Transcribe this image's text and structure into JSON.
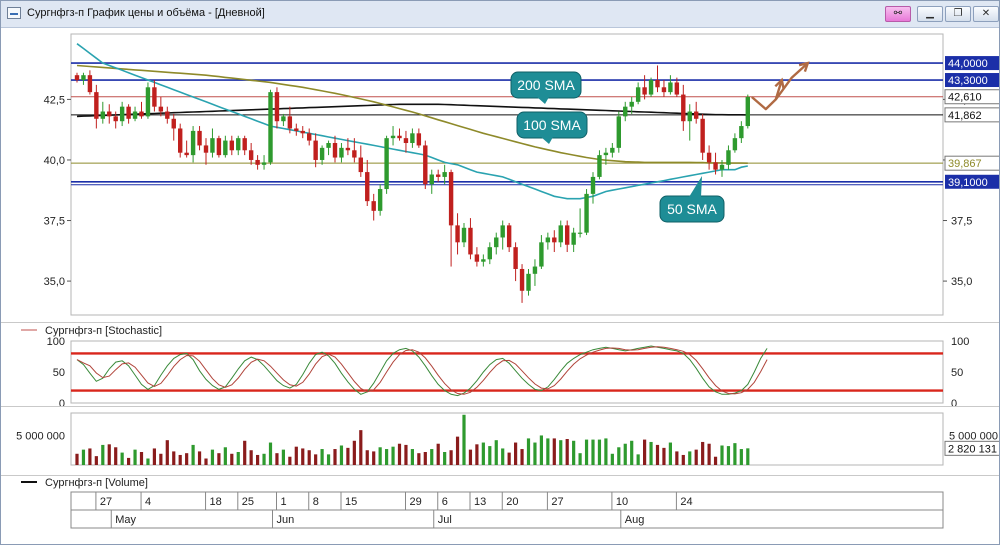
{
  "window": {
    "title": "Сургнфгз-п График цены и объёма - [Дневной]",
    "icons": [
      "chart-window-icon",
      "link-icon",
      "minimize-icon",
      "restore-icon",
      "close-icon"
    ]
  },
  "colors": {
    "up": "#2e9a2e",
    "down": "#c0201e",
    "sma50": "#2aa3b0",
    "sma100": "#8e8a2a",
    "sma200": "#111111",
    "level_blue": "#1b2fa8",
    "level_red": "#c0504d",
    "stoch_band": "#d9261c",
    "callout": "#1e8d96",
    "arrow": "#b06a43"
  },
  "price_pane": {
    "y_ticks": [
      "42,5",
      "40,0",
      "37,5",
      "35,0"
    ],
    "levels": [
      {
        "label": "44,0000",
        "value": 44.0,
        "style": "blue-box"
      },
      {
        "label": "43,3000",
        "value": 43.3,
        "style": "blue-box"
      },
      {
        "label": "42,610",
        "value": 42.61,
        "style": "red-text"
      },
      {
        "label": "41,862",
        "value": 41.862,
        "style": "black-text"
      },
      {
        "label": "39,867",
        "value": 39.867,
        "style": "olive-text"
      },
      {
        "label": "39,1000",
        "value": 39.1,
        "style": "blue-box"
      }
    ],
    "callouts": {
      "sma200": "200 SMA",
      "sma100": "100 SMA",
      "sma50": "50 SMA"
    }
  },
  "stoch_pane": {
    "legend": "Сургнфгз-п [Stochastic]",
    "left_ticks": [
      "100",
      "50",
      "0"
    ],
    "right_ticks": [
      "100",
      "50",
      "0"
    ],
    "bands": [
      80,
      20
    ]
  },
  "volume_pane": {
    "left_tick": "5 000 000",
    "right_tick": "5 000 000",
    "last_label": "2 820 131",
    "legend": "Сургнфгз-п [Volume]"
  },
  "date_axis": {
    "days": [
      "27",
      "4",
      "18",
      "25",
      "1",
      "8",
      "15",
      "29",
      "6",
      "13",
      "20",
      "27",
      "10",
      "24"
    ],
    "months": [
      "May",
      "Jun",
      "Jul",
      "Aug"
    ]
  },
  "chart_data": {
    "type": "candlestick",
    "y_range": [
      33.6,
      45.2
    ],
    "x_categories": [
      "27",
      "4",
      "18",
      "25",
      "1",
      "8",
      "15",
      "29",
      "6",
      "13",
      "20",
      "27",
      "10",
      "24"
    ],
    "months": [
      "May",
      "Jun",
      "Jul",
      "Aug"
    ],
    "horizontal_levels": [
      44.0,
      43.3,
      42.61,
      41.862,
      39.867,
      39.1
    ],
    "candles": [
      {
        "o": 43.5,
        "h": 43.6,
        "l": 43.2,
        "c": 43.3
      },
      {
        "o": 43.3,
        "h": 43.6,
        "l": 43.1,
        "c": 43.5
      },
      {
        "o": 43.5,
        "h": 43.7,
        "l": 42.7,
        "c": 42.8
      },
      {
        "o": 42.8,
        "h": 43.1,
        "l": 41.3,
        "c": 41.7
      },
      {
        "o": 41.7,
        "h": 42.4,
        "l": 41.5,
        "c": 42.0
      },
      {
        "o": 42.0,
        "h": 42.3,
        "l": 41.5,
        "c": 41.8
      },
      {
        "o": 41.8,
        "h": 42.0,
        "l": 41.3,
        "c": 41.6
      },
      {
        "o": 41.6,
        "h": 42.4,
        "l": 41.4,
        "c": 42.2
      },
      {
        "o": 42.2,
        "h": 42.3,
        "l": 41.5,
        "c": 41.7
      },
      {
        "o": 41.7,
        "h": 42.2,
        "l": 41.6,
        "c": 42.0
      },
      {
        "o": 42.0,
        "h": 42.4,
        "l": 41.7,
        "c": 41.8
      },
      {
        "o": 41.8,
        "h": 43.2,
        "l": 41.7,
        "c": 43.0
      },
      {
        "o": 43.0,
        "h": 43.3,
        "l": 42.0,
        "c": 42.2
      },
      {
        "o": 42.2,
        "h": 42.6,
        "l": 41.8,
        "c": 42.0
      },
      {
        "o": 42.0,
        "h": 42.2,
        "l": 41.5,
        "c": 41.7
      },
      {
        "o": 41.7,
        "h": 41.9,
        "l": 40.8,
        "c": 41.3
      },
      {
        "o": 41.3,
        "h": 41.5,
        "l": 40.1,
        "c": 40.3
      },
      {
        "o": 40.3,
        "h": 40.8,
        "l": 40.1,
        "c": 40.2
      },
      {
        "o": 40.2,
        "h": 41.4,
        "l": 39.9,
        "c": 41.2
      },
      {
        "o": 41.2,
        "h": 41.4,
        "l": 40.4,
        "c": 40.6
      },
      {
        "o": 40.6,
        "h": 40.9,
        "l": 39.8,
        "c": 40.3
      },
      {
        "o": 40.3,
        "h": 41.3,
        "l": 40.1,
        "c": 40.9
      },
      {
        "o": 40.9,
        "h": 41.0,
        "l": 40.1,
        "c": 40.2
      },
      {
        "o": 40.2,
        "h": 41.0,
        "l": 40.1,
        "c": 40.8
      },
      {
        "o": 40.8,
        "h": 41.0,
        "l": 40.2,
        "c": 40.4
      },
      {
        "o": 40.4,
        "h": 41.0,
        "l": 40.2,
        "c": 40.9
      },
      {
        "o": 40.9,
        "h": 41.0,
        "l": 40.2,
        "c": 40.4
      },
      {
        "o": 40.4,
        "h": 40.7,
        "l": 39.8,
        "c": 40.0
      },
      {
        "o": 40.0,
        "h": 40.2,
        "l": 39.6,
        "c": 39.8
      },
      {
        "o": 39.8,
        "h": 40.2,
        "l": 39.6,
        "c": 39.9
      },
      {
        "o": 39.9,
        "h": 42.9,
        "l": 39.8,
        "c": 42.8
      },
      {
        "o": 42.8,
        "h": 43.0,
        "l": 41.3,
        "c": 41.6
      },
      {
        "o": 41.6,
        "h": 41.9,
        "l": 41.4,
        "c": 41.8
      },
      {
        "o": 41.8,
        "h": 42.2,
        "l": 41.1,
        "c": 41.3
      },
      {
        "o": 41.3,
        "h": 41.5,
        "l": 41.0,
        "c": 41.2
      },
      {
        "o": 41.2,
        "h": 41.4,
        "l": 40.9,
        "c": 41.1
      },
      {
        "o": 41.1,
        "h": 41.3,
        "l": 40.6,
        "c": 40.8
      },
      {
        "o": 40.8,
        "h": 41.1,
        "l": 39.7,
        "c": 40.0
      },
      {
        "o": 40.0,
        "h": 40.6,
        "l": 39.8,
        "c": 40.5
      },
      {
        "o": 40.5,
        "h": 40.8,
        "l": 40.2,
        "c": 40.7
      },
      {
        "o": 40.7,
        "h": 41.0,
        "l": 39.9,
        "c": 40.1
      },
      {
        "o": 40.1,
        "h": 40.7,
        "l": 39.9,
        "c": 40.5
      },
      {
        "o": 40.5,
        "h": 40.9,
        "l": 40.2,
        "c": 40.4
      },
      {
        "o": 40.4,
        "h": 40.9,
        "l": 39.9,
        "c": 40.1
      },
      {
        "o": 40.1,
        "h": 40.6,
        "l": 39.3,
        "c": 39.5
      },
      {
        "o": 39.5,
        "h": 40.0,
        "l": 38.1,
        "c": 38.3
      },
      {
        "o": 38.3,
        "h": 38.6,
        "l": 37.5,
        "c": 37.9
      },
      {
        "o": 37.9,
        "h": 39.0,
        "l": 37.7,
        "c": 38.8
      },
      {
        "o": 38.8,
        "h": 41.0,
        "l": 38.6,
        "c": 40.9
      },
      {
        "o": 40.9,
        "h": 41.4,
        "l": 40.6,
        "c": 41.0
      },
      {
        "o": 41.0,
        "h": 41.3,
        "l": 40.8,
        "c": 40.9
      },
      {
        "o": 40.9,
        "h": 41.2,
        "l": 40.3,
        "c": 40.7
      },
      {
        "o": 40.7,
        "h": 41.3,
        "l": 40.5,
        "c": 41.1
      },
      {
        "o": 41.1,
        "h": 41.3,
        "l": 40.5,
        "c": 40.6
      },
      {
        "o": 40.6,
        "h": 40.8,
        "l": 38.8,
        "c": 39.0
      },
      {
        "o": 39.0,
        "h": 39.6,
        "l": 38.6,
        "c": 39.4
      },
      {
        "o": 39.4,
        "h": 39.6,
        "l": 39.1,
        "c": 39.3
      },
      {
        "o": 39.3,
        "h": 39.8,
        "l": 39.0,
        "c": 39.5
      },
      {
        "o": 39.5,
        "h": 39.6,
        "l": 35.6,
        "c": 37.3
      },
      {
        "o": 37.3,
        "h": 37.8,
        "l": 36.1,
        "c": 36.6
      },
      {
        "o": 36.6,
        "h": 37.4,
        "l": 36.4,
        "c": 37.2
      },
      {
        "o": 37.2,
        "h": 37.6,
        "l": 35.9,
        "c": 36.1
      },
      {
        "o": 36.1,
        "h": 36.4,
        "l": 35.6,
        "c": 35.8
      },
      {
        "o": 35.8,
        "h": 36.1,
        "l": 35.6,
        "c": 35.9
      },
      {
        "o": 35.9,
        "h": 36.6,
        "l": 35.7,
        "c": 36.4
      },
      {
        "o": 36.4,
        "h": 37.0,
        "l": 36.1,
        "c": 36.8
      },
      {
        "o": 36.8,
        "h": 37.5,
        "l": 36.3,
        "c": 37.3
      },
      {
        "o": 37.3,
        "h": 37.4,
        "l": 36.2,
        "c": 36.4
      },
      {
        "o": 36.4,
        "h": 36.6,
        "l": 35.0,
        "c": 35.5
      },
      {
        "o": 35.5,
        "h": 35.7,
        "l": 34.1,
        "c": 34.6
      },
      {
        "o": 34.6,
        "h": 35.5,
        "l": 34.4,
        "c": 35.3
      },
      {
        "o": 35.3,
        "h": 35.9,
        "l": 34.8,
        "c": 35.6
      },
      {
        "o": 35.6,
        "h": 36.9,
        "l": 35.5,
        "c": 36.6
      },
      {
        "o": 36.6,
        "h": 37.0,
        "l": 36.3,
        "c": 36.8
      },
      {
        "o": 36.8,
        "h": 37.1,
        "l": 36.2,
        "c": 36.6
      },
      {
        "o": 36.6,
        "h": 37.5,
        "l": 36.4,
        "c": 37.3
      },
      {
        "o": 37.3,
        "h": 37.5,
        "l": 36.2,
        "c": 36.5
      },
      {
        "o": 36.5,
        "h": 37.2,
        "l": 36.2,
        "c": 37.0
      },
      {
        "o": 37.0,
        "h": 38.0,
        "l": 36.8,
        "c": 37.0
      },
      {
        "o": 37.0,
        "h": 38.8,
        "l": 36.9,
        "c": 38.6
      },
      {
        "o": 38.6,
        "h": 39.5,
        "l": 38.2,
        "c": 39.3
      },
      {
        "o": 39.3,
        "h": 40.4,
        "l": 39.2,
        "c": 40.2
      },
      {
        "o": 40.2,
        "h": 40.5,
        "l": 39.8,
        "c": 40.3
      },
      {
        "o": 40.3,
        "h": 40.7,
        "l": 40.1,
        "c": 40.5
      },
      {
        "o": 40.5,
        "h": 42.0,
        "l": 40.3,
        "c": 41.8
      },
      {
        "o": 41.8,
        "h": 42.4,
        "l": 41.6,
        "c": 42.2
      },
      {
        "o": 42.2,
        "h": 42.6,
        "l": 41.9,
        "c": 42.4
      },
      {
        "o": 42.4,
        "h": 43.2,
        "l": 42.3,
        "c": 43.0
      },
      {
        "o": 43.0,
        "h": 43.5,
        "l": 42.5,
        "c": 42.7
      },
      {
        "o": 42.7,
        "h": 43.4,
        "l": 42.6,
        "c": 43.3
      },
      {
        "o": 43.3,
        "h": 43.9,
        "l": 42.8,
        "c": 43.0
      },
      {
        "o": 43.0,
        "h": 43.3,
        "l": 42.6,
        "c": 42.8
      },
      {
        "o": 42.8,
        "h": 43.5,
        "l": 42.7,
        "c": 43.2
      },
      {
        "o": 43.2,
        "h": 43.4,
        "l": 42.6,
        "c": 42.7
      },
      {
        "o": 42.7,
        "h": 43.1,
        "l": 41.2,
        "c": 41.6
      },
      {
        "o": 41.6,
        "h": 42.3,
        "l": 40.8,
        "c": 42.0
      },
      {
        "o": 42.0,
        "h": 42.4,
        "l": 41.5,
        "c": 41.7
      },
      {
        "o": 41.7,
        "h": 41.9,
        "l": 40.0,
        "c": 40.3
      },
      {
        "o": 40.3,
        "h": 40.6,
        "l": 39.6,
        "c": 39.9
      },
      {
        "o": 39.9,
        "h": 40.3,
        "l": 39.4,
        "c": 39.6
      },
      {
        "o": 39.6,
        "h": 40.0,
        "l": 39.3,
        "c": 39.8
      },
      {
        "o": 39.8,
        "h": 40.6,
        "l": 39.6,
        "c": 40.4
      },
      {
        "o": 40.4,
        "h": 41.1,
        "l": 40.3,
        "c": 40.9
      },
      {
        "o": 40.9,
        "h": 41.6,
        "l": 40.7,
        "c": 41.4
      },
      {
        "o": 41.4,
        "h": 42.7,
        "l": 41.3,
        "c": 42.6
      }
    ],
    "sma50": [
      44.8,
      44.6,
      44.4,
      44.2,
      44.0,
      43.9,
      43.8,
      43.7,
      43.6,
      43.5,
      43.4,
      43.3,
      43.2,
      43.1,
      43.0,
      42.9,
      42.8,
      42.7,
      42.6,
      42.5,
      42.4,
      42.3,
      42.2,
      42.1,
      42.0,
      41.9,
      41.8,
      41.7,
      41.6,
      41.5,
      41.4,
      41.35,
      41.3,
      41.25,
      41.2,
      41.15,
      41.1,
      41.05,
      41.0,
      40.95,
      40.9,
      40.85,
      40.8,
      40.75,
      40.7,
      40.65,
      40.6,
      40.55,
      40.5,
      40.45,
      40.4,
      40.35,
      40.3,
      40.25,
      40.2,
      40.1,
      40.0,
      39.9,
      39.85,
      39.8,
      39.7,
      39.6,
      39.5,
      39.45,
      39.4,
      39.35,
      39.3,
      39.2,
      39.1,
      39.0,
      38.9,
      38.8,
      38.7,
      38.6,
      38.5,
      38.45,
      38.4,
      38.4,
      38.4,
      38.45,
      38.5,
      38.6,
      38.7,
      38.75,
      38.8,
      38.85,
      38.9,
      38.95,
      39.0,
      39.05,
      39.1,
      39.15,
      39.2,
      39.25,
      39.3,
      39.35,
      39.4,
      39.45,
      39.5,
      39.55,
      39.6,
      39.6,
      39.6,
      39.7,
      39.75
    ],
    "sma100": [
      43.9,
      43.88,
      43.86,
      43.84,
      43.82,
      43.8,
      43.78,
      43.76,
      43.74,
      43.72,
      43.7,
      43.68,
      43.66,
      43.64,
      43.62,
      43.6,
      43.58,
      43.56,
      43.54,
      43.52,
      43.5,
      43.47,
      43.44,
      43.41,
      43.38,
      43.35,
      43.32,
      43.29,
      43.26,
      43.23,
      43.2,
      43.16,
      43.12,
      43.08,
      43.04,
      43.0,
      42.95,
      42.9,
      42.85,
      42.8,
      42.75,
      42.7,
      42.64,
      42.58,
      42.52,
      42.46,
      42.4,
      42.33,
      42.26,
      42.19,
      42.12,
      42.05,
      41.98,
      41.9,
      41.82,
      41.74,
      41.66,
      41.58,
      41.5,
      41.42,
      41.34,
      41.26,
      41.18,
      41.1,
      41.03,
      40.96,
      40.89,
      40.82,
      40.75,
      40.68,
      40.61,
      40.54,
      40.48,
      40.42,
      40.36,
      40.3,
      40.25,
      40.2,
      40.15,
      40.1,
      40.06,
      40.02,
      39.99,
      39.97,
      39.95,
      39.93,
      39.92,
      39.91,
      39.9,
      39.9,
      39.9,
      39.9,
      39.9,
      39.9,
      39.9,
      39.9,
      39.89,
      39.89,
      39.88,
      39.88,
      39.88,
      39.87,
      39.87,
      39.87,
      39.867
    ],
    "sma200": [
      41.8,
      41.81,
      41.82,
      41.83,
      41.84,
      41.85,
      41.86,
      41.87,
      41.88,
      41.89,
      41.9,
      41.91,
      41.92,
      41.93,
      41.94,
      41.95,
      41.96,
      41.97,
      41.98,
      41.99,
      42.0,
      42.01,
      42.02,
      42.03,
      42.04,
      42.05,
      42.06,
      42.07,
      42.08,
      42.09,
      42.1,
      42.11,
      42.12,
      42.13,
      42.14,
      42.15,
      42.16,
      42.17,
      42.18,
      42.19,
      42.2,
      42.21,
      42.22,
      42.23,
      42.24,
      42.25,
      42.26,
      42.27,
      42.28,
      42.29,
      42.3,
      42.3,
      42.3,
      42.3,
      42.3,
      42.3,
      42.3,
      42.29,
      42.28,
      42.27,
      42.26,
      42.25,
      42.24,
      42.23,
      42.22,
      42.21,
      42.2,
      42.19,
      42.18,
      42.17,
      42.16,
      42.15,
      42.14,
      42.13,
      42.12,
      42.11,
      42.1,
      42.09,
      42.08,
      42.07,
      42.06,
      42.05,
      42.04,
      42.03,
      42.02,
      42.01,
      42.0,
      41.99,
      41.98,
      41.97,
      41.96,
      41.95,
      41.94,
      41.93,
      41.92,
      41.91,
      41.9,
      41.89,
      41.88,
      41.87,
      41.87,
      41.866,
      41.864,
      41.863,
      41.862
    ],
    "projection_arrows": [
      [
        43.0,
        44.1
      ],
      [
        42.5,
        44.0
      ]
    ],
    "stochastic": [
      70,
      62,
      48,
      35,
      40,
      55,
      66,
      68,
      60,
      45,
      30,
      22,
      28,
      45,
      60,
      72,
      78,
      80,
      70,
      52,
      38,
      28,
      22,
      26,
      40,
      55,
      68,
      74,
      70,
      60,
      48,
      36,
      28,
      24,
      30,
      46,
      64,
      78,
      82,
      76,
      64,
      48,
      34,
      22,
      14,
      18,
      32,
      50,
      68,
      80,
      86,
      88,
      84,
      74,
      60,
      44,
      30,
      20,
      14,
      12,
      16,
      24,
      36,
      50,
      62,
      70,
      72,
      64,
      52,
      40,
      30,
      22,
      20,
      26,
      38,
      52,
      64,
      72,
      78,
      82,
      86,
      88,
      90,
      88,
      86,
      84,
      86,
      88,
      90,
      92,
      90,
      88,
      86,
      84,
      80,
      70,
      56,
      40,
      26,
      18,
      14,
      14,
      16,
      20,
      30,
      50,
      72,
      88
    ],
    "volume": [
      1.9,
      2.6,
      2.8,
      1.5,
      3.4,
      3.5,
      3.0,
      2.1,
      1.2,
      2.6,
      2.2,
      1.1,
      2.8,
      1.9,
      4.2,
      2.3,
      1.7,
      2.0,
      3.4,
      2.3,
      1.1,
      2.6,
      2.0,
      3.0,
      1.9,
      2.2,
      4.1,
      2.5,
      1.7,
      1.9,
      3.8,
      2.0,
      2.6,
      1.4,
      3.1,
      2.8,
      2.5,
      1.8,
      2.7,
      1.8,
      2.7,
      3.3,
      2.9,
      4.1,
      5.9,
      2.5,
      2.3,
      3.0,
      2.7,
      3.1,
      3.6,
      3.4,
      2.7,
      2.0,
      2.2,
      2.7,
      3.6,
      2.2,
      2.5,
      4.8,
      8.5,
      2.6,
      3.5,
      3.8,
      3.2,
      4.2,
      2.8,
      2.1,
      3.8,
      2.7,
      4.5,
      3.8,
      5.0,
      4.5,
      4.5,
      4.2,
      4.4,
      4.1,
      2.0,
      4.3,
      4.3,
      4.3,
      4.5,
      1.9,
      3.0,
      3.6,
      4.1,
      1.8,
      4.3,
      3.9,
      3.4,
      2.9,
      3.8,
      2.3,
      1.7,
      2.3,
      2.6,
      3.9,
      3.6,
      1.4,
      3.3,
      3.2,
      3.7,
      2.7,
      2.82
    ],
    "volume_unit": "million"
  }
}
